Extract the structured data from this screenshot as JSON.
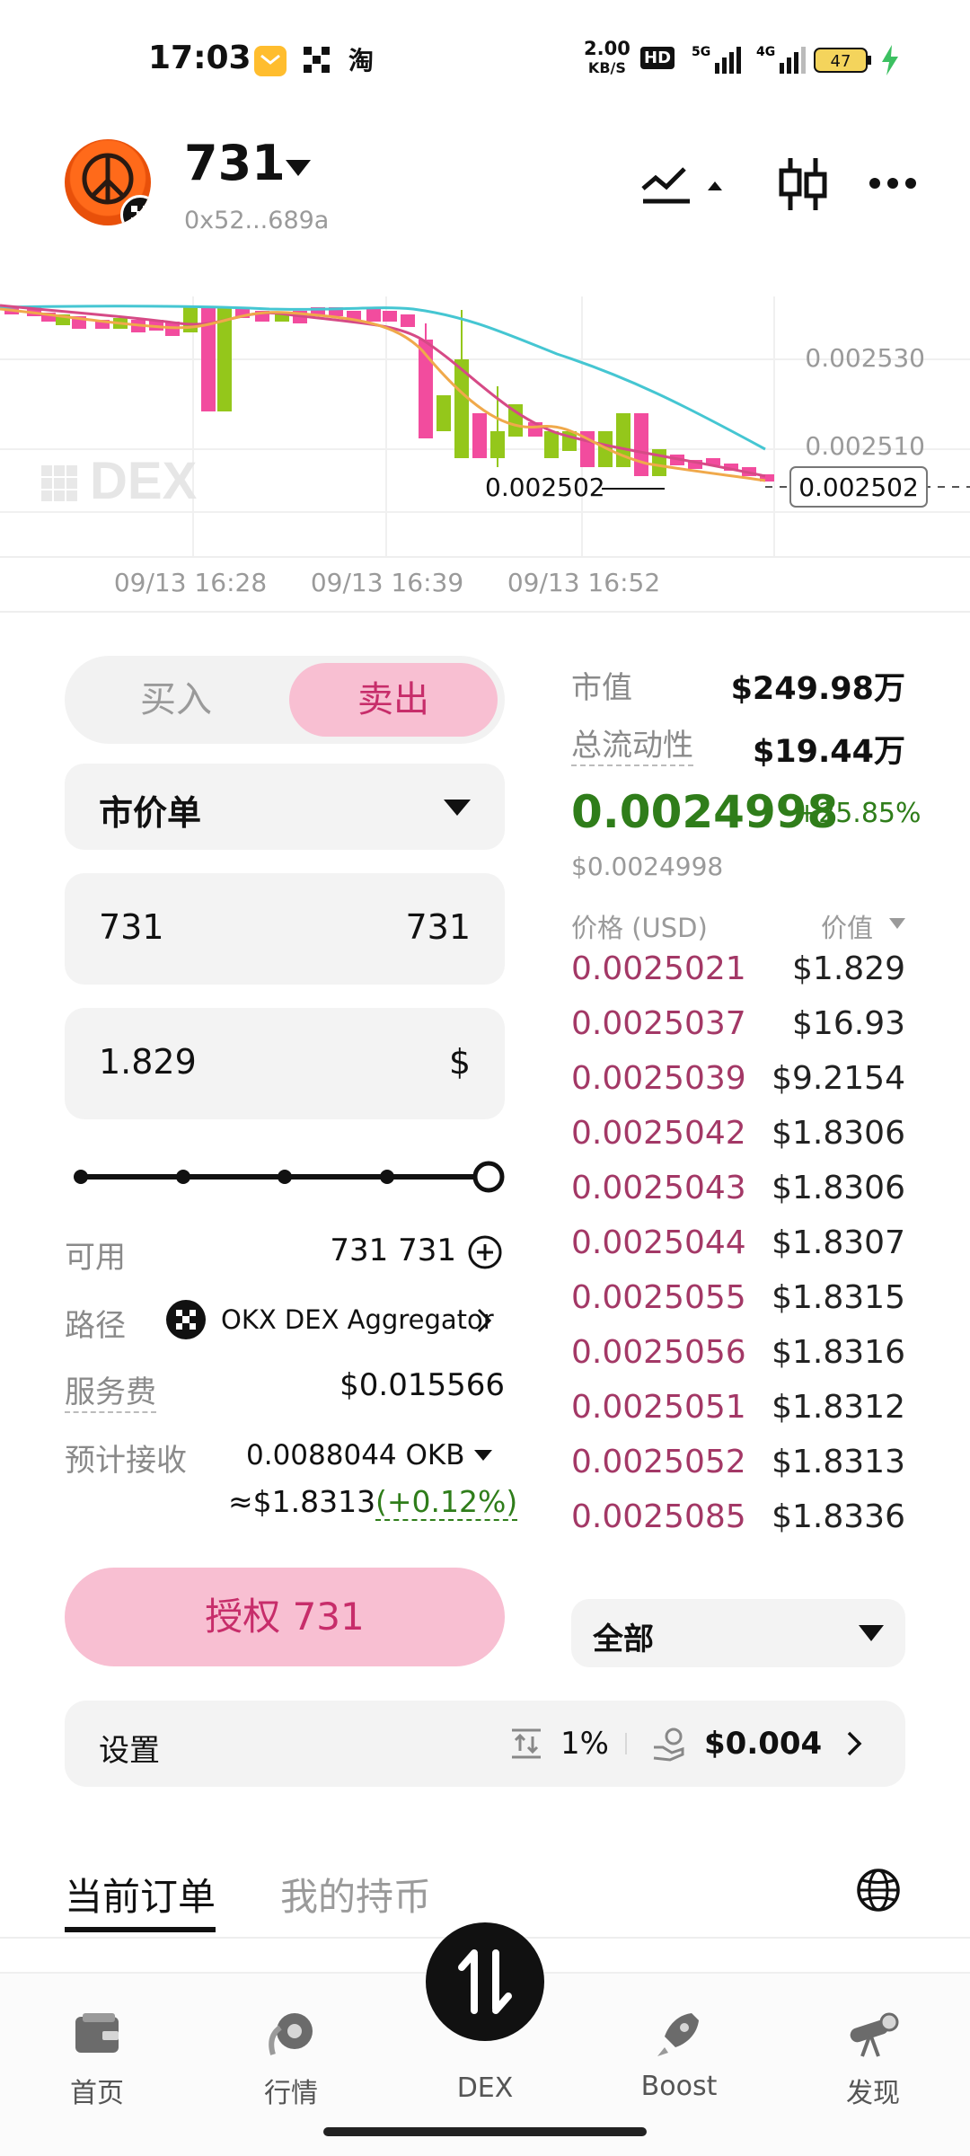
{
  "status_bar": {
    "time": "17:03",
    "net_speed_top": "2.00",
    "net_speed_unit": "KB/S",
    "battery": "47",
    "app3": "淘",
    "sig1": "5G",
    "sig2": "4G",
    "hd": "HD"
  },
  "token": {
    "name": "731",
    "address": "0x52...689a"
  },
  "chart": {
    "price_labels": [
      "0.002530",
      "0.002510"
    ],
    "current_price_label": "0.002502",
    "low_label": "0.002502",
    "watermark": "DEX",
    "time_labels": [
      "09/13 16:28",
      "09/13 16:39",
      "09/13 16:52"
    ],
    "colors": {
      "up": "#94c71b",
      "down": "#f24c9e",
      "ma_cyan": "#45c6d2",
      "ma_orange": "#f0a94b",
      "ma_pink": "#d64a86"
    }
  },
  "trade": {
    "buy_label": "买入",
    "sell_label": "卖出",
    "order_type": "市价单",
    "amount_value": "731",
    "amount_unit": "731",
    "usd_value": "1.829",
    "usd_unit": "$",
    "slider_fraction": 1.0,
    "available_label": "可用",
    "available_value": "731 731",
    "route_label": "路径",
    "route_value": "OKX DEX Aggregator",
    "fee_label": "服务费",
    "fee_value": "$0.015566",
    "receive_label": "预计接收",
    "receive_value": "0.0088044 OKB",
    "receive_usd": "≈$1.8313",
    "receive_change": "(+0.12%)",
    "authorize_label": "授权 731"
  },
  "info": {
    "mcap_label": "市值",
    "mcap_value": "$249.98万",
    "liq_label": "总流动性",
    "liq_value": "$19.44万",
    "price": "0.0024998",
    "change": "+25.85%",
    "price_usd": "$0.0024998",
    "col_price": "价格 (USD)",
    "col_value": "价值"
  },
  "orderbook": [
    {
      "price": "0.0025021",
      "value": "$1.829"
    },
    {
      "price": "0.0025037",
      "value": "$16.93"
    },
    {
      "price": "0.0025039",
      "value": "$9.2154"
    },
    {
      "price": "0.0025042",
      "value": "$1.8306"
    },
    {
      "price": "0.0025043",
      "value": "$1.8306"
    },
    {
      "price": "0.0025044",
      "value": "$1.8307"
    },
    {
      "price": "0.0025055",
      "value": "$1.8315"
    },
    {
      "price": "0.0025056",
      "value": "$1.8316"
    },
    {
      "price": "0.0025051",
      "value": "$1.8312"
    },
    {
      "price": "0.0025052",
      "value": "$1.8313"
    },
    {
      "price": "0.0025085",
      "value": "$1.8336"
    }
  ],
  "filter": {
    "label": "全部"
  },
  "settings": {
    "label": "设置",
    "slippage": "1%",
    "gas": "$0.004"
  },
  "tabs": {
    "current_orders": "当前订单",
    "my_holdings": "我的持币"
  },
  "nav": {
    "home": "首页",
    "market": "行情",
    "dex": "DEX",
    "boost": "Boost",
    "discover": "发现"
  }
}
